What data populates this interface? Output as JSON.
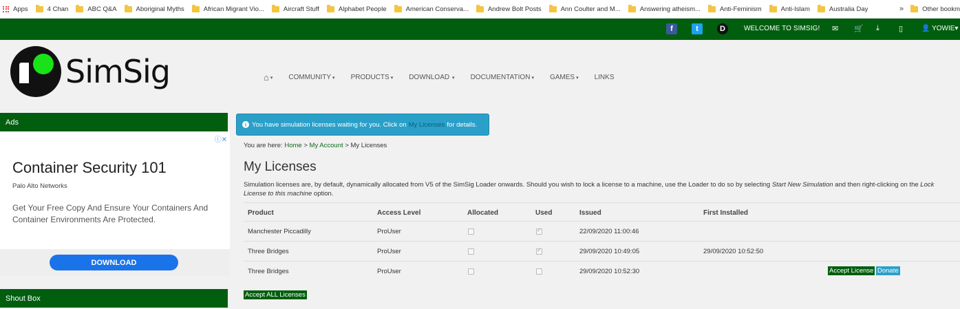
{
  "bookmarks": {
    "apps_label": "Apps",
    "items": [
      "4 Chan",
      "ABC Q&A",
      "Aboriginal Myths",
      "African Migrant Vio...",
      "Aircraft Stuff",
      "Alphabet People",
      "American Conserva...",
      "Andrew Bolt Posts",
      "Ann Coulter and M...",
      "Answering atheism...",
      "Anti-Feminism",
      "Anti-Islam",
      "Australia Day"
    ],
    "more_label": "»",
    "other_label": "Other bookm"
  },
  "topbar": {
    "facebook_glyph": "f",
    "twitter_glyph": "t",
    "discord_glyph": "D",
    "welcome": "WELCOME TO SIMSIG!",
    "user_label": "YOWIE",
    "caret": "▾"
  },
  "header": {
    "logo_text": "SimSig",
    "nav": [
      {
        "label": "COMMUNITY"
      },
      {
        "label": "PRODUCTS"
      },
      {
        "label": "DOWNLOAD"
      },
      {
        "label": "DOCUMENTATION"
      },
      {
        "label": "GAMES"
      },
      {
        "label": "LINKS"
      }
    ]
  },
  "sidebar": {
    "ads_title": "Ads",
    "shout_title": "Shout Box",
    "ad": {
      "title": "Container Security 101",
      "company": "Palo Alto Networks",
      "body": "Get Your Free Copy And Ensure Your Containers And Container Environments Are Protected.",
      "button": "DOWNLOAD"
    }
  },
  "alert": {
    "text_before": "You have simulation licenses waiting for you. Click on",
    "link": "My Licenses",
    "text_after": "for details."
  },
  "breadcrumb": {
    "prefix": "You are here:",
    "home": "Home",
    "sep": ">",
    "account": "My Account",
    "current": "My Licenses"
  },
  "page": {
    "title": "My Licenses",
    "desc_1": "Simulation licenses are, by default, dynamically allocated from V5 of the SimSig Loader onwards. Should you wish to lock a license to a machine, use the Loader to do so by selecting",
    "desc_em1": "Start New Simulation",
    "desc_2": "and then right-clicking on the",
    "desc_em2": "Lock License to this machine",
    "desc_3": "option."
  },
  "table": {
    "headers": [
      "Product",
      "Access Level",
      "Allocated",
      "Used",
      "Issued",
      "First Installed"
    ],
    "rows": [
      {
        "product": "Manchester Piccadilly",
        "access": "ProUser",
        "allocated": false,
        "used": true,
        "issued": "22/09/2020 11:00:46",
        "first_installed": ""
      },
      {
        "product": "Three Bridges",
        "access": "ProUser",
        "allocated": false,
        "used": true,
        "issued": "29/09/2020 10:49:05",
        "first_installed": "29/09/2020 10:52:50"
      },
      {
        "product": "Three Bridges",
        "access": "ProUser",
        "allocated": false,
        "used": false,
        "issued": "29/09/2020 10:52:30",
        "first_installed": ""
      }
    ],
    "accept_label": "Accept License",
    "donate_label": "Donate"
  },
  "accept_all_label": "Accept ALL Licenses"
}
